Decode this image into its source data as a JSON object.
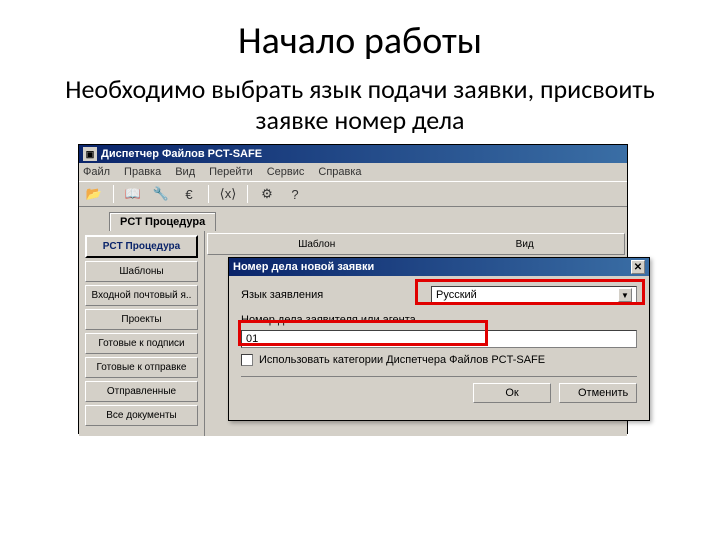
{
  "slide": {
    "title": "Начало работы",
    "subtitle": "Необходимо выбрать язык подачи заявки, присвоить заявке номер дела"
  },
  "mainWindow": {
    "title": "Диспетчер Файлов PCT-SAFE",
    "menu": [
      "Файл",
      "Правка",
      "Вид",
      "Перейти",
      "Сервис",
      "Справка"
    ],
    "toolbar": [
      "📂",
      "📖",
      "🔧",
      "€",
      "⟨x⟩",
      "⚙",
      "?"
    ],
    "tab": "PCT Процедура",
    "sidebar": [
      {
        "label": "PCT Процедура",
        "active": true
      },
      {
        "label": "Шаблоны",
        "active": false
      },
      {
        "label": "Входной почтовый я..",
        "active": false
      },
      {
        "label": "Проекты",
        "active": false
      },
      {
        "label": "Готовые к подписи",
        "active": false
      },
      {
        "label": "Готовые к отправке",
        "active": false
      },
      {
        "label": "Отправленные",
        "active": false
      },
      {
        "label": "Все документы",
        "active": false
      }
    ],
    "panelHeaders": [
      "Шаблон",
      "Вид"
    ]
  },
  "dialog": {
    "title": "Номер дела новой заявки",
    "labels": {
      "language": "Язык заявления",
      "caseNumber": "Номер дела заявителя или агента",
      "checkbox": "Использовать категории Диспетчера Файлов PCT-SAFE"
    },
    "values": {
      "language": "Русский",
      "caseNumber": "01"
    },
    "buttons": {
      "ok": "Ок",
      "cancel": "Отменить"
    }
  }
}
